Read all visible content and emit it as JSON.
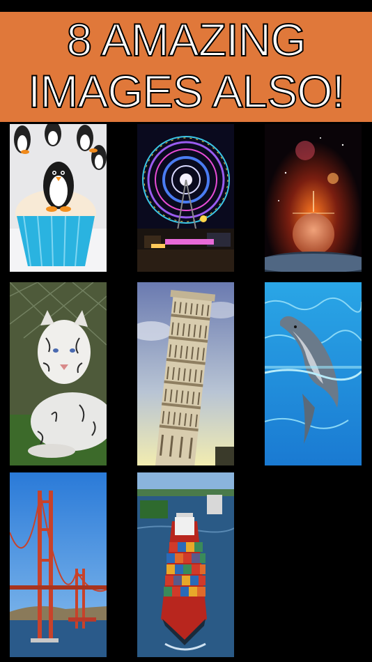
{
  "banner": {
    "line1": "8 AMAZING",
    "line2": "IMAGES ALSO!",
    "background_color": "#e0783a"
  },
  "gallery": {
    "images": [
      {
        "subject": "penguin-cupcake"
      },
      {
        "subject": "ferris-wheel-night"
      },
      {
        "subject": "planet-space"
      },
      {
        "subject": "white-tiger"
      },
      {
        "subject": "leaning-tower-pisa"
      },
      {
        "subject": "dolphin"
      },
      {
        "subject": "golden-gate-bridge"
      },
      {
        "subject": "container-ship"
      }
    ]
  }
}
